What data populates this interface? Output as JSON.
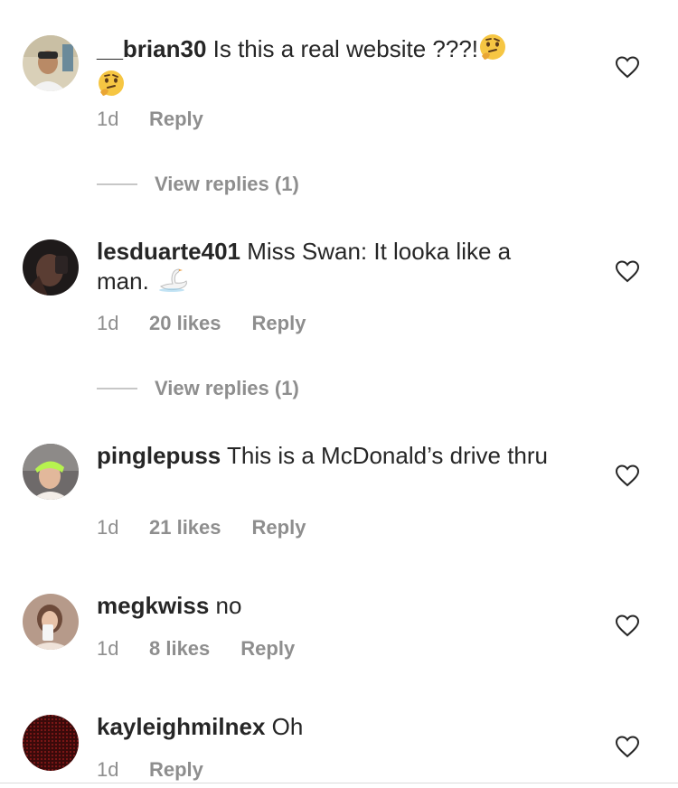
{
  "comments": [
    {
      "username": "__brian30",
      "text": "Is this a real website ???!",
      "emoji": [
        "thinking-face",
        "thinking-face"
      ],
      "time": "1d",
      "likes": "",
      "reply": "Reply",
      "view_replies": "View replies (1)"
    },
    {
      "username": "lesduarte401",
      "text": "Miss Swan: It looka like a man.",
      "emoji": [
        "swan"
      ],
      "time": "1d",
      "likes": "20 likes",
      "reply": "Reply",
      "view_replies": "View replies (1)"
    },
    {
      "username": "pinglepuss",
      "text": "This is a McDonald’s drive thru",
      "time": "1d",
      "likes": "21 likes",
      "reply": "Reply"
    },
    {
      "username": "megkwiss",
      "text": "no",
      "time": "1d",
      "likes": "8 likes",
      "reply": "Reply"
    },
    {
      "username": "kayleighmilnex",
      "text": "Oh",
      "time": "1d",
      "likes": "",
      "reply": "Reply"
    }
  ],
  "icons": {
    "like": "heart-outline-icon"
  },
  "colors": {
    "text": "#262626",
    "secondary": "#8e8e8e",
    "divider": "#c7c7c7"
  }
}
